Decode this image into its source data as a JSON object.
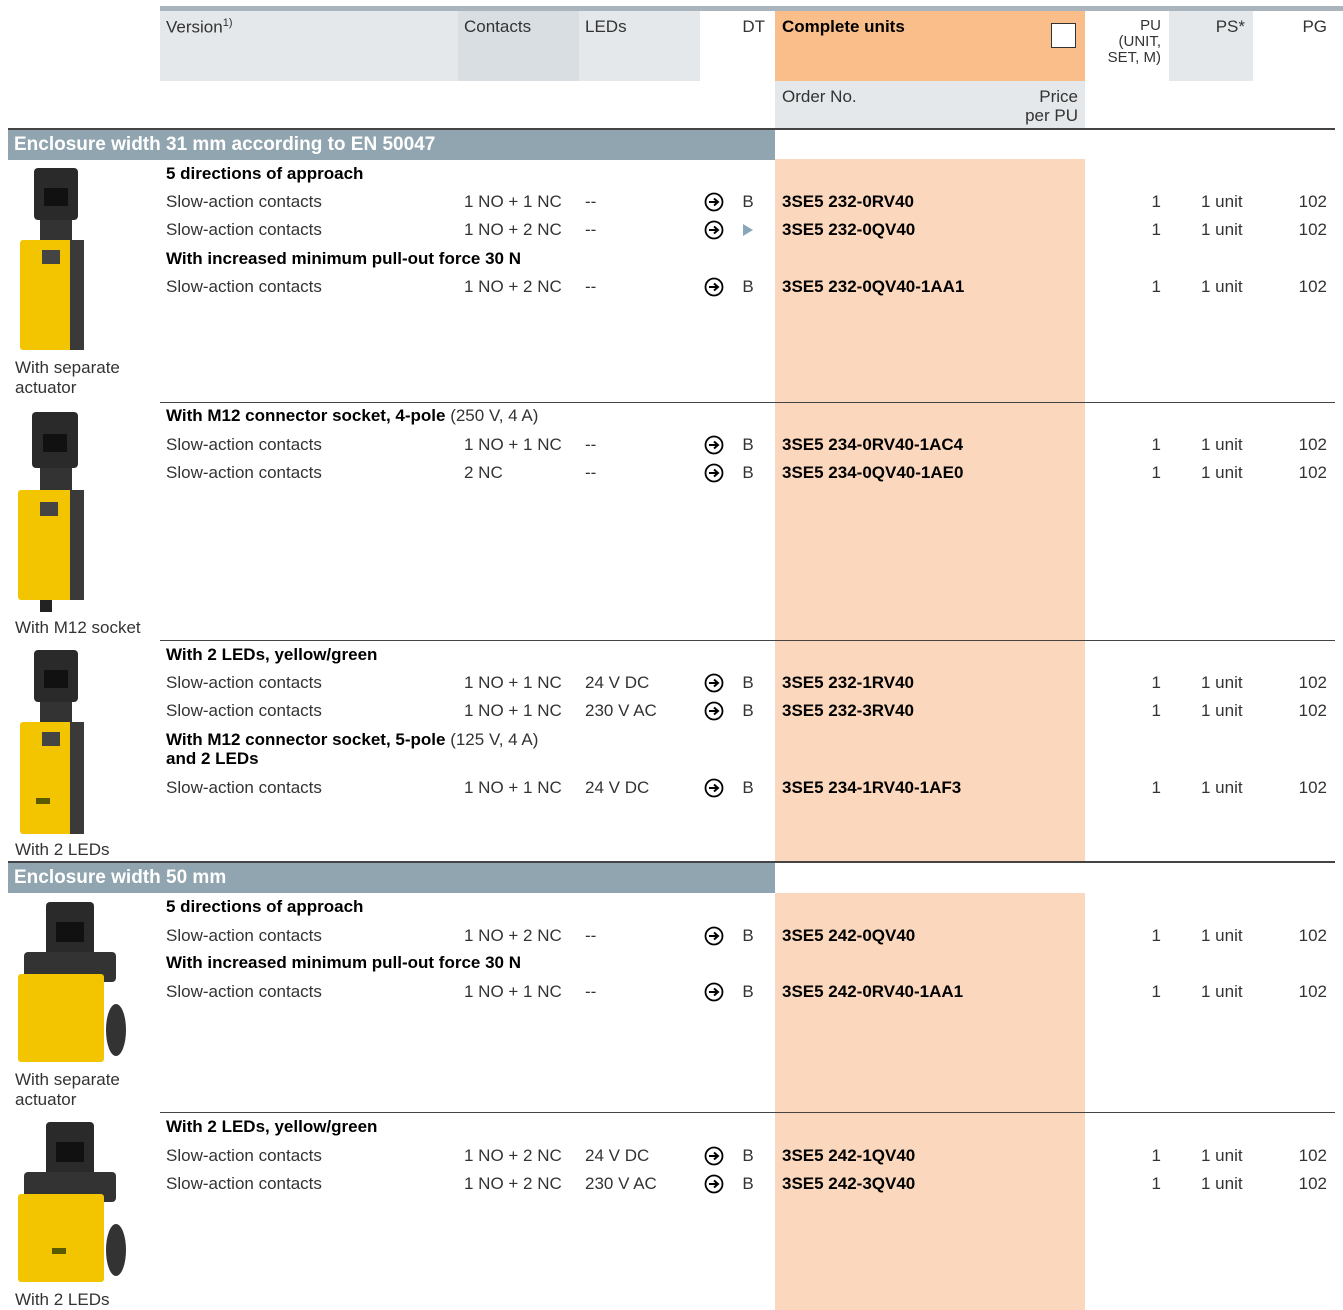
{
  "header": {
    "version": "Version",
    "version_sup": "1)",
    "contacts": "Contacts",
    "leds": "LEDs",
    "dt": "DT",
    "complete_units": "Complete units",
    "pu": "PU\n(UNIT,\nSET, M)",
    "ps": "PS*",
    "pg": "PG",
    "order_no": "Order No.",
    "price": "Price\nper PU"
  },
  "sections": [
    {
      "title": "Enclosure width 31 mm according to EN 50047"
    },
    {
      "title": "Enclosure width 50 mm"
    }
  ],
  "photos": [
    {
      "caption": "With separate\nactuator",
      "icon": "yellow-safety-switch-slim-icon"
    },
    {
      "caption": "With M12 socket",
      "icon": "yellow-safety-switch-m12-icon"
    },
    {
      "caption": "With 2 LEDs",
      "icon": "yellow-safety-switch-leds-icon"
    },
    {
      "caption": "With separate\nactuator",
      "icon": "yellow-safety-switch-wide-icon"
    },
    {
      "caption": "With 2 LEDs",
      "icon": "yellow-safety-switch-wide-leds-icon"
    }
  ],
  "subheads": [
    {
      "bold": "5 directions of approach",
      "normal": ""
    },
    {
      "bold": "With increased minimum pull-out force 30 N",
      "normal": ""
    },
    {
      "bold": "With M12 connector socket, 4-pole",
      "normal": " (250 V, 4 A)"
    },
    {
      "bold": "With 2 LEDs, yellow/green",
      "normal": ""
    },
    {
      "bold": "With M12 connector socket, 5-pole",
      "normal": " (125 V, 4 A)",
      "bold2": "and 2 LEDs"
    },
    {
      "bold": "5 directions of approach",
      "normal": ""
    },
    {
      "bold": "With increased minimum pull-out force 30 N",
      "normal": ""
    },
    {
      "bold": "With 2 LEDs, yellow/green",
      "normal": ""
    }
  ],
  "rows": [
    {
      "version": "Slow-action contacts",
      "contacts": "1 NO + 1 NC",
      "leds": "--",
      "dt": "B",
      "order": "3SE5 232-0RV40",
      "pu": "1",
      "ps": "1 unit",
      "pg": "102"
    },
    {
      "version": "Slow-action contacts",
      "contacts": "1 NO + 2 NC",
      "leds": "--",
      "dt": "",
      "order": "3SE5 232-0QV40",
      "pu": "1",
      "ps": "1 unit",
      "pg": "102"
    },
    {
      "version": "Slow-action contacts",
      "contacts": "1 NO + 2 NC",
      "leds": "--",
      "dt": "B",
      "order": "3SE5 232-0QV40-1AA1",
      "pu": "1",
      "ps": "1 unit",
      "pg": "102"
    },
    {
      "version": "Slow-action contacts",
      "contacts": "1 NO + 1 NC",
      "leds": "--",
      "dt": "B",
      "order": "3SE5 234-0RV40-1AC4",
      "pu": "1",
      "ps": "1 unit",
      "pg": "102"
    },
    {
      "version": "Slow-action contacts",
      "contacts": "2 NC",
      "leds": "--",
      "dt": "B",
      "order": "3SE5 234-0QV40-1AE0",
      "pu": "1",
      "ps": "1 unit",
      "pg": "102"
    },
    {
      "version": "Slow-action contacts",
      "contacts": "1 NO + 1 NC",
      "leds": "24 V DC",
      "dt": "B",
      "order": "3SE5 232-1RV40",
      "pu": "1",
      "ps": "1 unit",
      "pg": "102"
    },
    {
      "version": "Slow-action contacts",
      "contacts": "1 NO + 1 NC",
      "leds": "230 V AC",
      "dt": "B",
      "order": "3SE5 232-3RV40",
      "pu": "1",
      "ps": "1 unit",
      "pg": "102"
    },
    {
      "version": "Slow-action contacts",
      "contacts": "1 NO + 1 NC",
      "leds": "24 V DC",
      "dt": "B",
      "order": "3SE5 234-1RV40-1AF3",
      "pu": "1",
      "ps": "1 unit",
      "pg": "102"
    },
    {
      "version": "Slow-action contacts",
      "contacts": "1 NO + 2 NC",
      "leds": "--",
      "dt": "B",
      "order": "3SE5 242-0QV40",
      "pu": "1",
      "ps": "1 unit",
      "pg": "102"
    },
    {
      "version": "Slow-action contacts",
      "contacts": "1 NO + 1 NC",
      "leds": "--",
      "dt": "B",
      "order": "3SE5 242-0RV40-1AA1",
      "pu": "1",
      "ps": "1 unit",
      "pg": "102"
    },
    {
      "version": "Slow-action contacts",
      "contacts": "1 NO + 2 NC",
      "leds": "24 V DC",
      "dt": "B",
      "order": "3SE5 242-1QV40",
      "pu": "1",
      "ps": "1 unit",
      "pg": "102"
    },
    {
      "version": "Slow-action contacts",
      "contacts": "1 NO + 2 NC",
      "leds": "230 V AC",
      "dt": "B",
      "order": "3SE5 242-3QV40",
      "pu": "1",
      "ps": "1 unit",
      "pg": "102"
    }
  ],
  "colors": {
    "section_bar": "#90a5b0",
    "orange_header": "#f9be89",
    "orange_column": "#fbd8bd",
    "header_shade": "#e4e8eb",
    "arrow_blue": "#8aa6ba"
  }
}
